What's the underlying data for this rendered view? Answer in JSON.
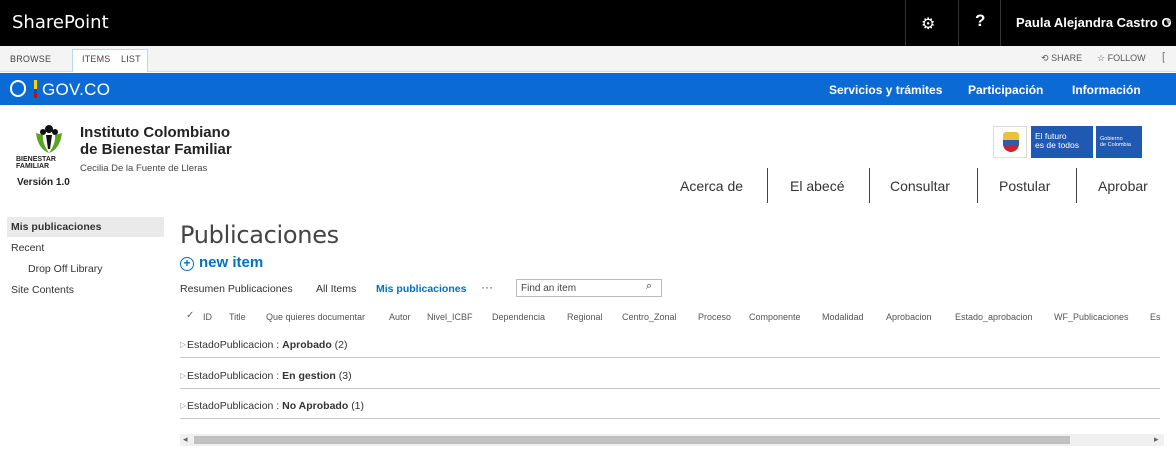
{
  "suitebar": {
    "brand": "SharePoint",
    "settings_icon": "gear-icon",
    "help": "?",
    "user": "Paula Alejandra Castro O",
    "caret": "▾"
  },
  "ribbon": {
    "tabs": [
      "BROWSE",
      "ITEMS",
      "LIST"
    ],
    "share": "SHARE",
    "follow": "FOLLOW"
  },
  "gov": {
    "brand": "GOV.CO",
    "links": [
      "Servicios y trámites",
      "Participación",
      "Información"
    ],
    "futuro_line1": "El futuro",
    "futuro_line2": "es de todos",
    "gobierno_line1": "Gobierno",
    "gobierno_line2": "de Colombia"
  },
  "header": {
    "title_line1": "Instituto Colombiano",
    "title_line2": "de Bienestar Familiar",
    "logo_line1": "BIENESTAR",
    "logo_line2": "FAMILIAR",
    "subtitle": "Cecilia De la Fuente de Lleras",
    "version": "Versión 1.0",
    "nav": [
      "Acerca de",
      "El abecé",
      "Consultar",
      "Postular",
      "Aprobar"
    ]
  },
  "leftnav": {
    "items": [
      "Mis publicaciones",
      "Recent",
      "Drop Off Library",
      "Site Contents"
    ]
  },
  "main": {
    "title": "Publicaciones",
    "new_item": "new item",
    "views": [
      "Resumen Publicaciones",
      "All Items",
      "Mis publicaciones"
    ],
    "ellipsis": "···",
    "search_placeholder": "Find an item",
    "columns": [
      "ID",
      "Title",
      "Que quieres documentar",
      "Autor",
      "Nivel_ICBF",
      "Dependencia",
      "Regional",
      "Centro_Zonal",
      "Proceso",
      "Componente",
      "Modalidad",
      "Aprobacion",
      "Estado_aprobacion",
      "WF_Publicaciones",
      "Es"
    ],
    "groups": [
      {
        "prefix": "EstadoPublicacion : ",
        "value": "Aprobado",
        "count": "(2)"
      },
      {
        "prefix": "EstadoPublicacion : ",
        "value": "En gestion",
        "count": "(3)"
      },
      {
        "prefix": "EstadoPublicacion : ",
        "value": "No Aprobado",
        "count": "(1)"
      }
    ]
  },
  "colors": {
    "suitebar": "#000000",
    "gov_blue": "#0c6ad4",
    "link_blue": "#0072c6"
  }
}
